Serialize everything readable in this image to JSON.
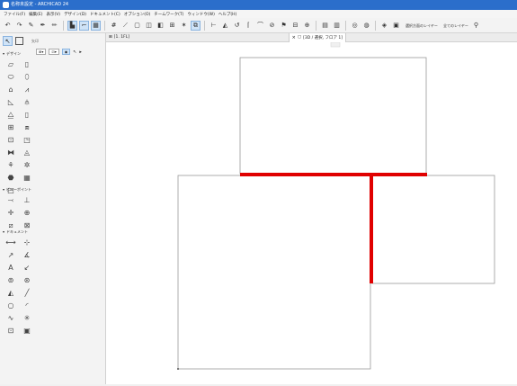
{
  "titlebar": {
    "title": "名称未設定 - ARCHICAD 24"
  },
  "menu": [
    "ファイル(F)",
    "編集(E)",
    "表示(V)",
    "デザイン(D)",
    "ドキュメント(C)",
    "オプション(O)",
    "チームワーク(T)",
    "ウィンドウ(W)",
    "ヘルプ(H)"
  ],
  "toolbar": {
    "layer_label": "選択方面のレイヤー",
    "all_layers_label": "全てのレイヤー"
  },
  "palette": {
    "arrow_label": "矢印",
    "sections": {
      "design": "デザイン",
      "viewpoint": "ビューポイント",
      "document": "ドキュメント"
    }
  },
  "tabs": [
    {
      "label": "[1. 1FL]",
      "icon": "floorplan-icon"
    },
    {
      "label": "[3D / 選択, フロア 1]",
      "icon": "3d-icon"
    }
  ],
  "colors": {
    "titlebar": "#2b6ecb",
    "wall": "#e00000",
    "selection": "#cfe3f7"
  }
}
